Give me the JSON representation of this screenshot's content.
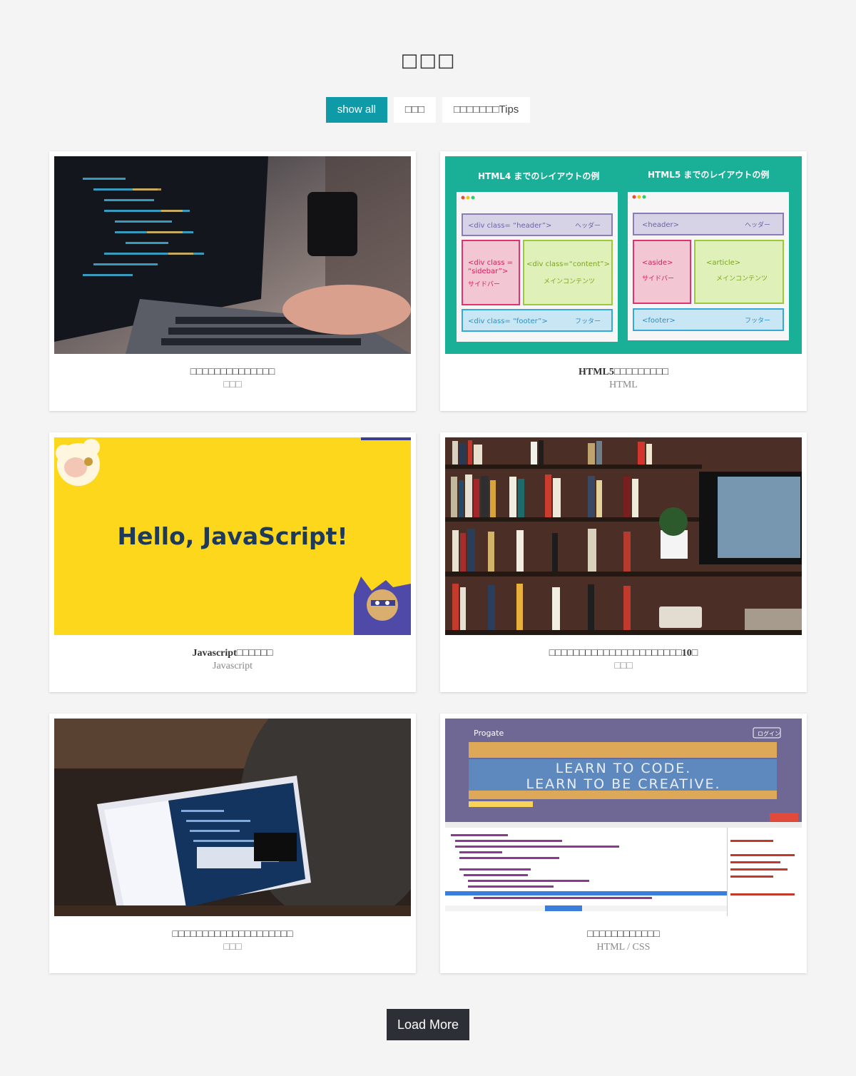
{
  "page": {
    "title": "□□□"
  },
  "filters": [
    {
      "label": "show all",
      "active": true
    },
    {
      "label": "□□□"
    },
    {
      "label": "□□□□□□□Tips"
    }
  ],
  "cards": [
    {
      "title": "□□□□□□□□□□□□□□",
      "category": "□□□"
    },
    {
      "title": "HTML5□□□□□□□□□",
      "category": "HTML",
      "image_text": {
        "left_heading": "HTML4 までのレイアウトの例",
        "right_heading": "HTML5 までのレイアウトの例",
        "left_header": "<div class= “header”>",
        "left_header_jp": "ヘッダー",
        "left_sidebar_1": "<div class =",
        "left_sidebar_2": "“sidebar”>",
        "left_sidebar_jp": "サイドバー",
        "left_content": "<div class=“content”>",
        "left_content_jp": "メインコンテンツ",
        "left_footer": "<div class= “footer”>",
        "left_footer_jp": "フッター",
        "right_header": "<header>",
        "right_header_jp": "ヘッダー",
        "right_aside": "<aside>",
        "right_aside_jp": "サイドバー",
        "right_article": "<article>",
        "right_article_jp": "メインコンテンツ",
        "right_footer": "<footer>",
        "right_footer_jp": "フッター"
      }
    },
    {
      "title": "Javascript□□□□□□",
      "category": "Javascript",
      "image_text": {
        "headline": "Hello, JavaScript!"
      }
    },
    {
      "title": "□□□□□□□□□□□□□□□□□□□□□□10□",
      "category": "□□□"
    },
    {
      "title": "□□□□□□□□□□□□□□□□□□□□",
      "category": "□□□"
    },
    {
      "title": "□□□□□□□□□□□□",
      "category": "HTML / CSS",
      "image_text": {
        "brand": "Progate",
        "login": "ログイン",
        "line1": "LEARN TO CODE.",
        "line2": "LEARN TO BE CREATIVE."
      }
    }
  ],
  "load_more": {
    "label": "Load More"
  },
  "colors": {
    "accent": "#0f9aa8",
    "dark_button": "#2d2f36",
    "teal_image": "#1aaf97",
    "yellow_image": "#fdd71c"
  }
}
